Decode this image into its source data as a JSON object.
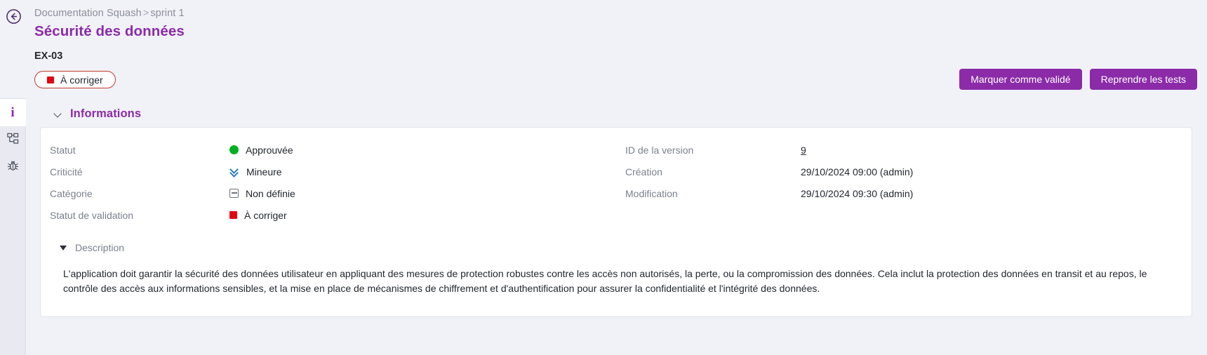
{
  "header": {
    "back_icon": "arrow-left-circle-icon",
    "breadcrumb": {
      "project": "Documentation Squash",
      "separator": ">",
      "sprint": "sprint 1"
    },
    "title": "Sécurité des données",
    "reference": "EX-03",
    "status_pill": {
      "label": "À corriger",
      "dot_color": "#e20613",
      "border_color": "#c0392b"
    },
    "actions": [
      {
        "label": "Marquer comme validé",
        "name": "mark-as-validated-button"
      },
      {
        "label": "Reprendre les tests",
        "name": "resume-tests-button"
      }
    ]
  },
  "rail": {
    "items": [
      {
        "icon": "information-icon",
        "name": "rail-item-information",
        "active": true
      },
      {
        "icon": "hierarchy-tree-icon",
        "name": "rail-item-hierarchy",
        "active": false
      },
      {
        "icon": "bug-icon",
        "name": "rail-item-bugs",
        "active": false
      }
    ]
  },
  "informations": {
    "section_title": "Informations",
    "left_fields": [
      {
        "label": "Statut",
        "value": "Approuvée",
        "icon": "green-circle-icon",
        "color": "#00b020"
      },
      {
        "label": "Criticité",
        "value": "Mineure",
        "icon": "double-chevron-down-icon",
        "color": "#2e7bbf"
      },
      {
        "label": "Catégorie",
        "value": "Non définie",
        "icon": "minus-box-icon",
        "color": "#6e7280"
      },
      {
        "label": "Statut de validation",
        "value": "À corriger",
        "icon": "red-square-icon",
        "color": "#e20613"
      }
    ],
    "right_fields": [
      {
        "label": "ID de la version",
        "value": "9",
        "link": true
      },
      {
        "label": "Création",
        "value": "29/10/2024 09:00 (admin)",
        "link": false
      },
      {
        "label": "Modification",
        "value": "29/10/2024 09:30 (admin)",
        "link": false
      }
    ],
    "description": {
      "title": "Description",
      "text": "L'application doit garantir la sécurité des données utilisateur en appliquant des mesures de protection robustes contre les accès non autorisés, la perte, ou la compromission des données. Cela inclut la protection des données en transit et au repos, le contrôle des accès aux informations sensibles, et la mise en place de mécanismes de chiffrement et d'authentification pour assurer la confidentialité et l'intégrité des données."
    }
  },
  "theme": {
    "accent": "#8b2ba8",
    "page_bg": "#f1f2f7",
    "card_bg": "#ffffff",
    "muted_text": "#7c808d"
  }
}
